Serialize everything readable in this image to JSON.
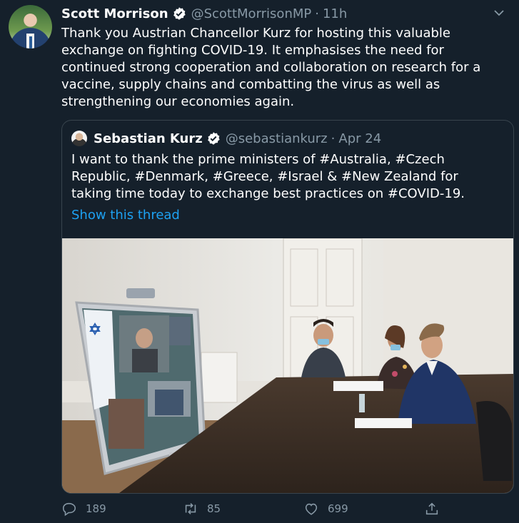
{
  "tweet": {
    "author_name": "Scott Morrison",
    "handle": "@ScottMorrisonMP",
    "separator": "·",
    "time": "11h",
    "text": "Thank you Austrian Chancellor Kurz for hosting this valuable\nexchange on fighting COVID-19. It emphasises the need for\ncontinued strong cooperation and collaboration on research for a\nvaccine, supply chains and combatting the virus as well as\nstrengthening our economies again."
  },
  "quote": {
    "author_name": "Sebastian Kurz",
    "handle": "@sebastiankurz",
    "separator": "·",
    "date": "Apr 24",
    "text": "I want to thank the prime ministers of #Australia, #Czech\n Republic, #Denmark, #Greece, #Israel & #New Zealand for\ntaking time today to exchange best practices on #COVID-19.",
    "thread_link": "Show this thread"
  },
  "actions": {
    "replies": "189",
    "retweets": "85",
    "likes": "699"
  },
  "icons": [
    "verified-icon",
    "more-icon",
    "reply-icon",
    "retweet-icon",
    "like-icon",
    "share-icon"
  ],
  "colors": {
    "background": "#15202b",
    "secondary_text": "#8899a6",
    "link": "#1da1f2",
    "verified": "#ffffff",
    "border": "#38444d"
  }
}
